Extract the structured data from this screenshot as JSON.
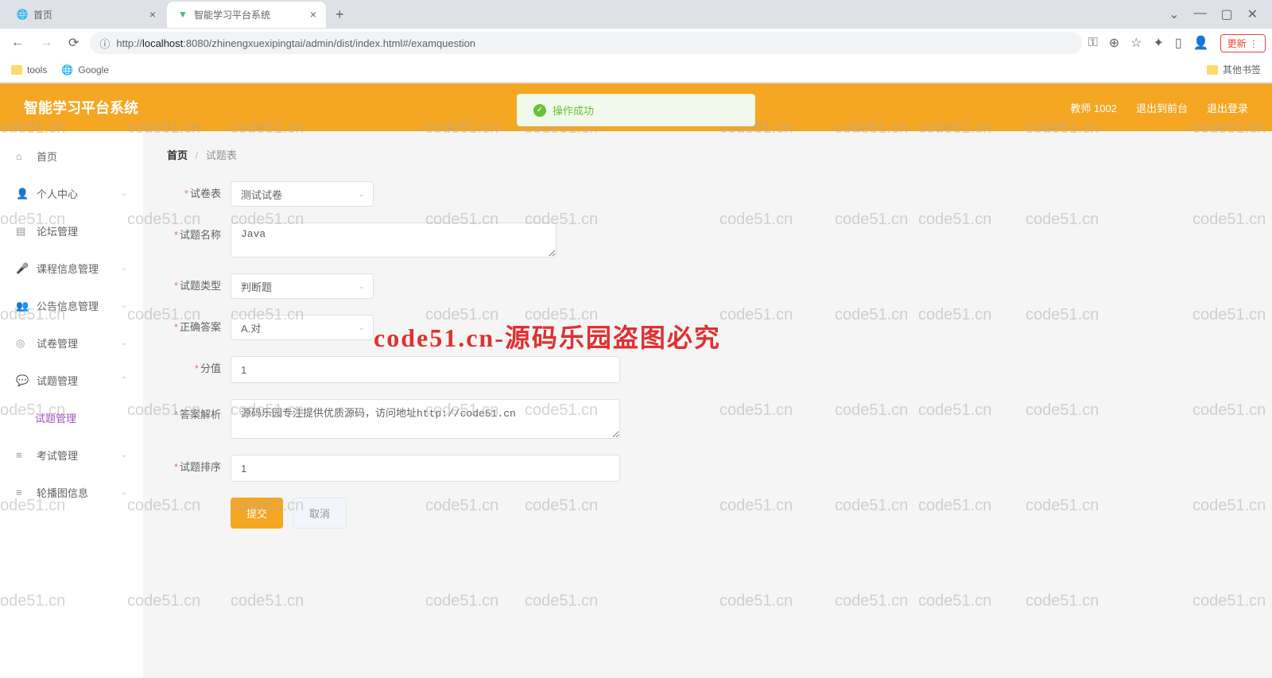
{
  "browser": {
    "tabs": [
      {
        "title": "首页",
        "favicon": "globe"
      },
      {
        "title": "智能学习平台系统",
        "favicon": "vue"
      }
    ],
    "url_prefix": "http://",
    "url_host": "localhost",
    "url_path": ":8080/zhinengxuexipingtai/admin/dist/index.html#/examquestion",
    "update_label": "更新",
    "bookmarks": {
      "tools": "tools",
      "google": "Google",
      "other": "其他书签"
    }
  },
  "app": {
    "title": "智能学习平台系统",
    "header_right": {
      "user": "教师 1002",
      "logout_front": "退出到前台",
      "logout": "退出登录"
    },
    "toast": "操作成功"
  },
  "sidebar": {
    "home": "首页",
    "personal": "个人中心",
    "forum": "论坛管理",
    "course": "课程信息管理",
    "notice": "公告信息管理",
    "exam_paper": "试卷管理",
    "exam_question": "试题管理",
    "exam_question_sub": "试题管理",
    "exam": "考试管理",
    "carousel": "轮播图信息"
  },
  "breadcrumb": {
    "home": "首页",
    "current": "试题表"
  },
  "form": {
    "paper": {
      "label": "试卷表",
      "value": "测试试卷"
    },
    "name": {
      "label": "试题名称",
      "value": "Java"
    },
    "type": {
      "label": "试题类型",
      "value": "判断题"
    },
    "answer": {
      "label": "正确答案",
      "value": "A.对"
    },
    "score": {
      "label": "分值",
      "value": "1"
    },
    "analysis": {
      "label": "答案解析",
      "value": "源码乐园专注提供优质源码，访问地址http://code51.cn"
    },
    "sort": {
      "label": "试题排序",
      "value": "1"
    },
    "submit": "提交",
    "cancel": "取消"
  },
  "watermark": {
    "text": "code51.cn",
    "center": "code51.cn-源码乐园盗图必究"
  }
}
